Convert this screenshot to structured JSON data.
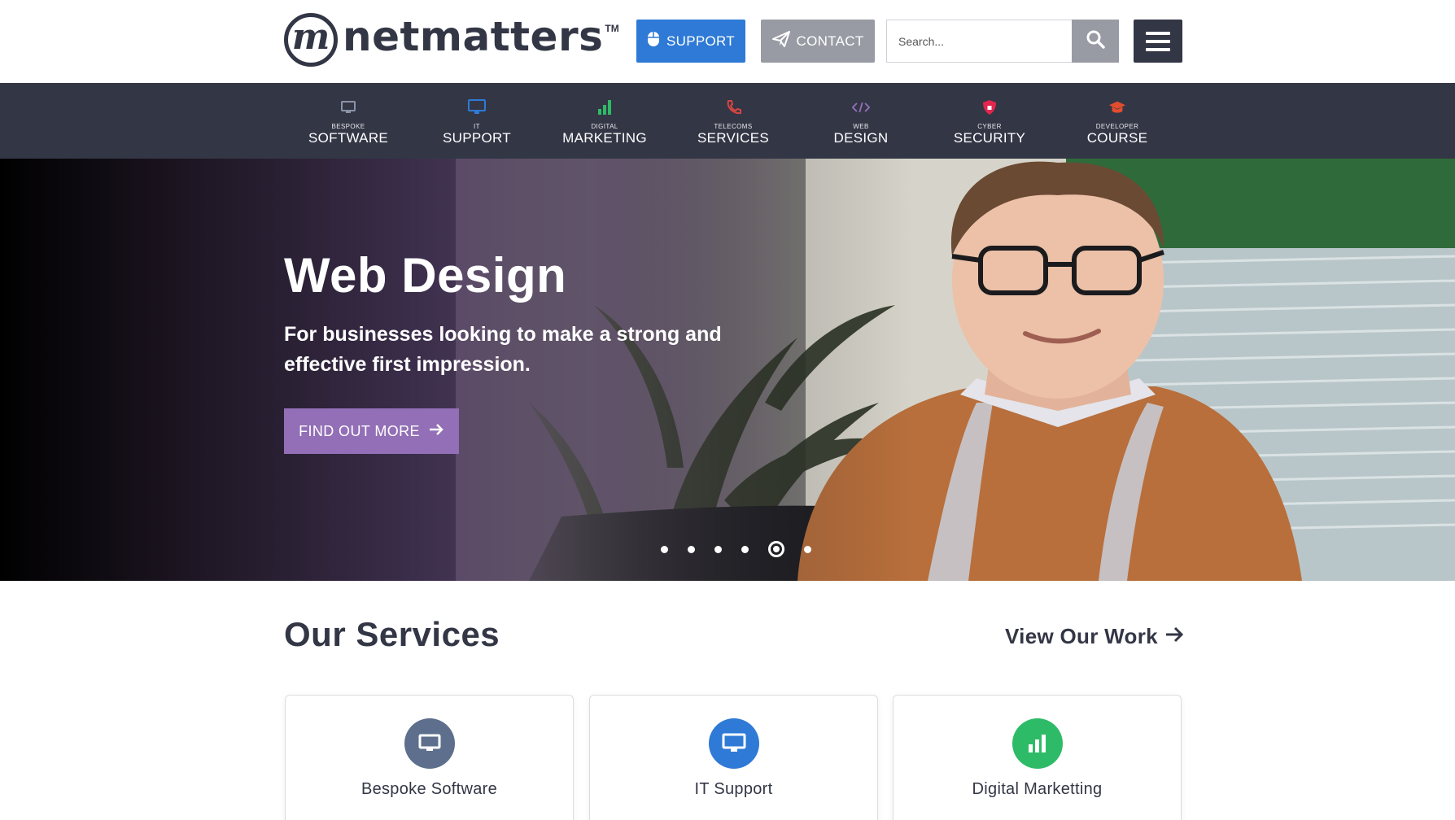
{
  "header": {
    "logo_mark": "m",
    "logo_text": "netmatters",
    "logo_tm": "TM",
    "support_label": "SUPPORT",
    "contact_label": "CONTACT",
    "search_placeholder": "Search...",
    "colors": {
      "support": "#2e7ad6",
      "contact": "#999ba4",
      "menu": "#333645"
    }
  },
  "nav": {
    "items": [
      {
        "small": "BESPOKE",
        "big": "SOFTWARE",
        "icon": "monitor-icon",
        "color": "#6b7a94"
      },
      {
        "small": "IT",
        "big": "SUPPORT",
        "icon": "desktop-icon",
        "color": "#2e7ad6"
      },
      {
        "small": "DIGITAL",
        "big": "MARKETING",
        "icon": "bar-chart-icon",
        "color": "#2ebb67"
      },
      {
        "small": "TELECOMS",
        "big": "SERVICES",
        "icon": "phone-icon",
        "color": "#d64541"
      },
      {
        "small": "WEB",
        "big": "DESIGN",
        "icon": "code-icon",
        "color": "#926fb6"
      },
      {
        "small": "CYBER",
        "big": "SECURITY",
        "icon": "shield-icon",
        "color": "#e2264d"
      },
      {
        "small": "DEVELOPER",
        "big": "COURSE",
        "icon": "graduation-cap-icon",
        "color": "#e24d2e"
      }
    ]
  },
  "hero": {
    "title": "Web Design",
    "subtitle": "For businesses looking to make a strong and effective first impression.",
    "cta_label": "FIND OUT MORE",
    "slide_count": 6,
    "active_slide": 5,
    "cta_color": "#926fb6"
  },
  "services": {
    "title": "Our Services",
    "view_work_label": "View Our Work",
    "cards": [
      {
        "title": "Bespoke Software",
        "icon": "monitor-icon",
        "color": "#5d6f8c"
      },
      {
        "title": "IT Support",
        "icon": "desktop-icon",
        "color": "#2e7ad6"
      },
      {
        "title": "Digital Marketting",
        "icon": "bar-chart-icon",
        "color": "#2ebb67"
      }
    ]
  }
}
